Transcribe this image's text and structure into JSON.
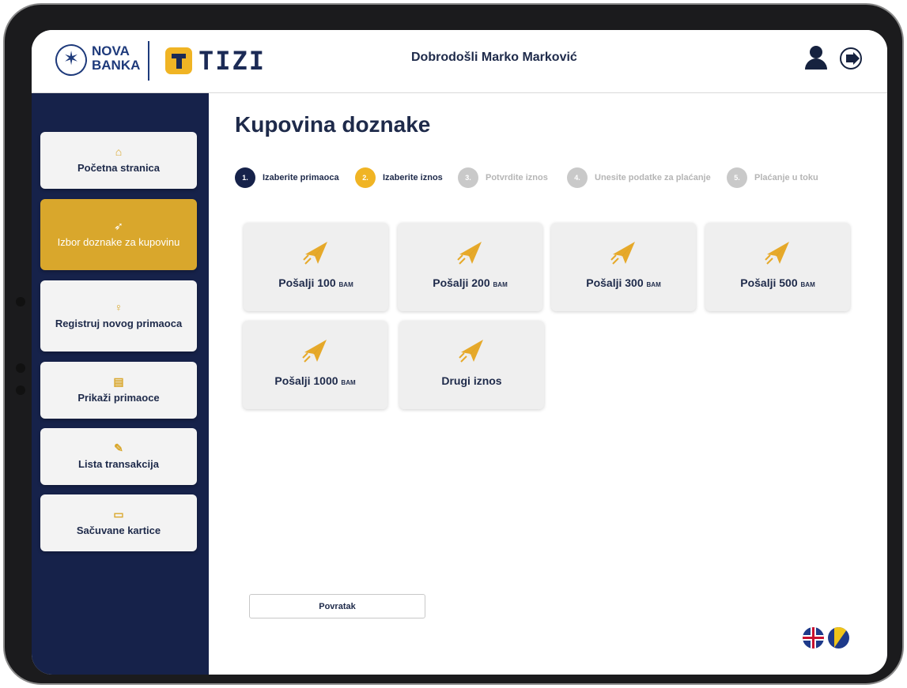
{
  "header": {
    "brand_bank": "NOVA\nBANKA",
    "brand_app": "TIZI",
    "welcome": "Dobrodošli Marko Marković"
  },
  "sidebar": {
    "items": [
      {
        "label": "Početna stranica",
        "icon": "home-icon"
      },
      {
        "label": "Izbor doznake za kupovinu",
        "icon": "send-plane-icon",
        "active": true
      },
      {
        "label": "Registruj novog primaoca",
        "icon": "add-user-icon"
      },
      {
        "label": "Prikaži primaoce",
        "icon": "document-icon"
      },
      {
        "label": "Lista transakcija",
        "icon": "list-edit-icon"
      },
      {
        "label": "Sačuvane kartice",
        "icon": "card-icon"
      }
    ]
  },
  "main": {
    "title": "Kupovina doznake",
    "steps": [
      {
        "num": "1.",
        "label": "Izaberite primaoca",
        "state": "done"
      },
      {
        "num": "2.",
        "label": "Izaberite iznos",
        "state": "current"
      },
      {
        "num": "3.",
        "label": "Potvrdite iznos",
        "state": "todo"
      },
      {
        "num": "4.",
        "label": "Unesite podatke za plaćanje",
        "state": "todo"
      },
      {
        "num": "5.",
        "label": "Plaćanje u toku",
        "state": "todo"
      }
    ],
    "amounts": [
      {
        "label": "Pošalji 100",
        "currency": "BAM"
      },
      {
        "label": "Pošalji 200",
        "currency": "BAM"
      },
      {
        "label": "Pošalji 300",
        "currency": "BAM"
      },
      {
        "label": "Pošalji 500",
        "currency": "BAM"
      },
      {
        "label": "Pošalji 1000",
        "currency": "BAM"
      },
      {
        "label": "Drugi iznos",
        "currency": ""
      }
    ],
    "back_label": "Povratak"
  },
  "colors": {
    "navy": "#16224a",
    "gold": "#d9a72c",
    "card_bg": "#efefef"
  }
}
